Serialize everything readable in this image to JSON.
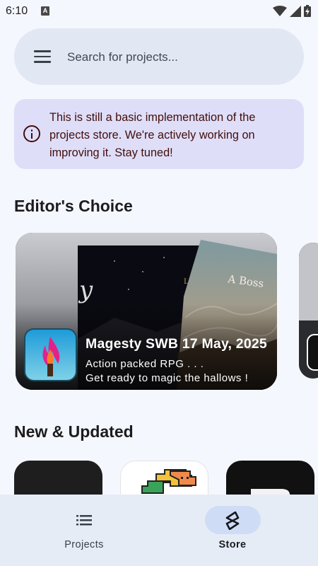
{
  "status_bar": {
    "time": "6:10",
    "notification_badge": "A",
    "icons": [
      "wifi-icon",
      "signal-icon",
      "battery-icon"
    ]
  },
  "search": {
    "placeholder": "Search for projects..."
  },
  "info_banner": {
    "text": "This is still a basic implementation of the projects store. We're actively working on improving it. Stay tuned!"
  },
  "editors_choice": {
    "title": "Editor's Choice",
    "featured": {
      "name": "Magesty SWB 17 May, 2025",
      "description": "Action packed RPG . . .\nGet ready to magic the hallows !"
    }
  },
  "new_updated": {
    "title": "New & Updated"
  },
  "bottom_nav": {
    "items": [
      {
        "label": "Projects",
        "icon": "list-icon",
        "selected": false
      },
      {
        "label": "Store",
        "icon": "store-logo-icon",
        "selected": true
      }
    ]
  },
  "colors": {
    "background": "#f5f7fe",
    "search_bg": "#e1e8f4",
    "banner_bg": "#dfdef9",
    "banner_text": "#410e0b",
    "nav_bg": "#e6ecf6",
    "nav_selected_pill": "#cfdcf5"
  }
}
